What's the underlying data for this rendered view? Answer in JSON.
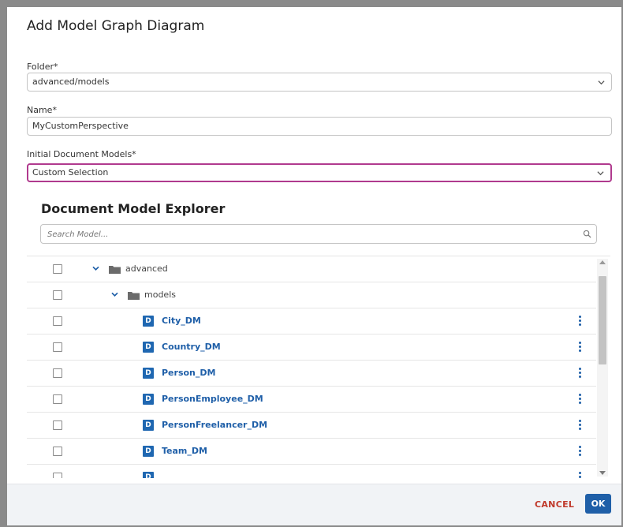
{
  "dialog": {
    "title": "Add Model Graph Diagram"
  },
  "form": {
    "folder_label": "Folder*",
    "folder_value": "advanced/models",
    "name_label": "Name*",
    "name_value": "MyCustomPerspective",
    "initial_models_label": "Initial Document Models*",
    "initial_models_value": "Custom Selection"
  },
  "explorer": {
    "title": "Document Model Explorer",
    "search_placeholder": "Search Model...",
    "folders": [
      {
        "name": "advanced"
      },
      {
        "name": "models"
      }
    ],
    "badge": "D",
    "models": [
      {
        "name": "City_DM"
      },
      {
        "name": "Country_DM"
      },
      {
        "name": "Person_DM"
      },
      {
        "name": "PersonEmployee_DM"
      },
      {
        "name": "PersonFreelancer_DM"
      },
      {
        "name": "Team_DM"
      }
    ]
  },
  "footer": {
    "cancel_label": "CANCEL",
    "ok_label": "OK"
  },
  "colors": {
    "accent": "#1f5fa8",
    "focus_border": "#b03a8e",
    "cancel_text": "#c0392b"
  },
  "icons": [
    "chevron-down-icon",
    "search-icon",
    "folder-icon",
    "kebab-menu-icon"
  ]
}
